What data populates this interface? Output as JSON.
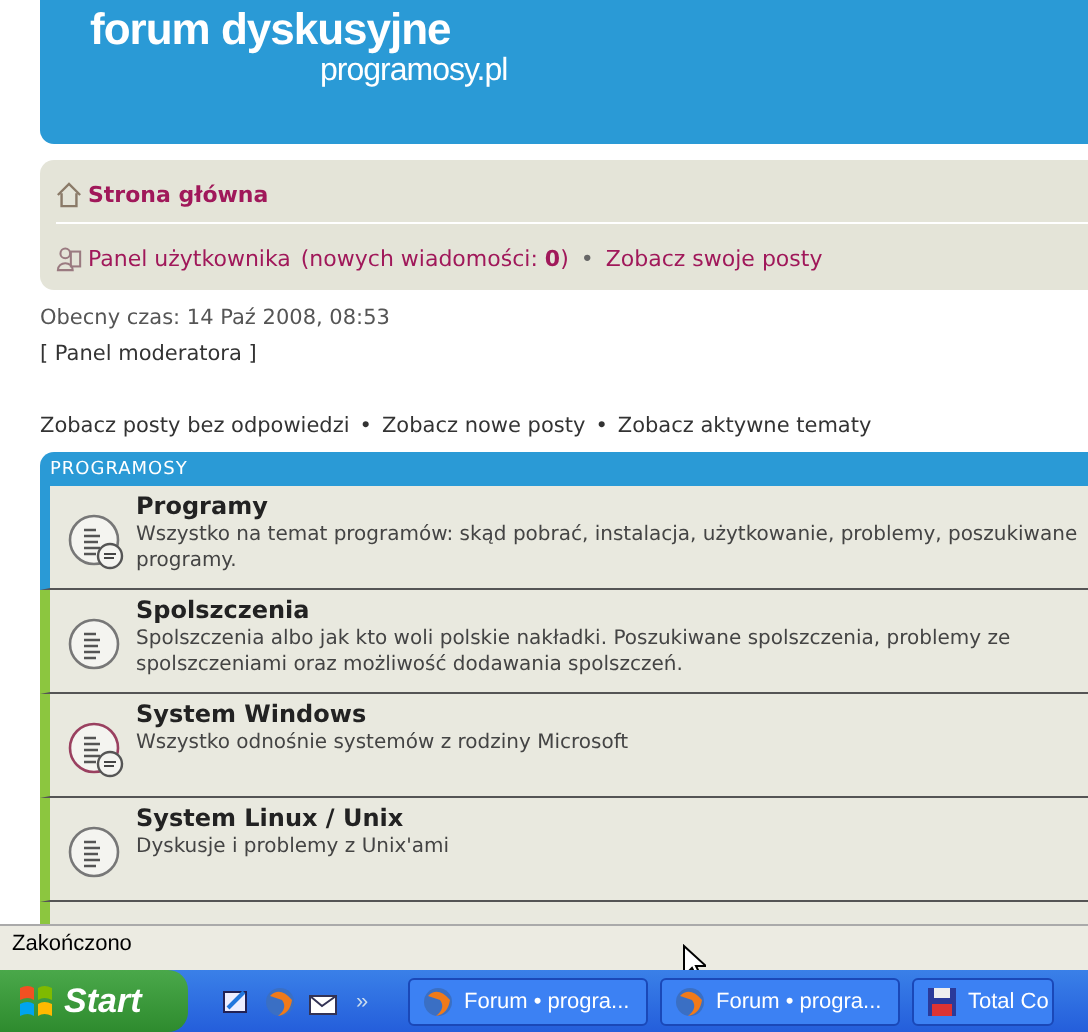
{
  "header": {
    "title": "forum dyskusyjne",
    "subtitle": "programosy.pl"
  },
  "nav": {
    "home": "Strona główna",
    "panel": "Panel użytkownika",
    "new_messages": "(nowych wiadomości: **0**)",
    "separator": "•",
    "own_posts": "Zobacz swoje posty"
  },
  "current_time": "Obecny czas: 14 Paź 2008, 08:53",
  "moderator_panel": "[ Panel moderatora ]",
  "quick_links": [
    "Zobacz posty bez odpowiedzi",
    "Zobacz nowe posty",
    "Zobacz aktywne tematy"
  ],
  "quick_separators": [
    "•",
    "•"
  ],
  "category": {
    "title": "PROGRAMOSY",
    "forums": [
      {
        "name": "Programy",
        "description": "Wszystko na temat programów: skąd pobrać, instalacja, użytkowanie, problemy, poszukiwane programy.",
        "new_posts": true,
        "color": "#2a9ad6"
      },
      {
        "name": "Spolszczenia",
        "description": "Spolszczenia albo jak kto woli polskie nakładki. Poszukiwane spolszczenia, problemy ze spolszczeniami oraz możliwość dodawania spolszczeń.",
        "new_posts": false,
        "color": "#8cc63f"
      },
      {
        "name": "System Windows",
        "description": "Wszystko odnośnie systemów z rodziny Microsoft",
        "new_posts": true,
        "color": "#8cc63f"
      },
      {
        "name": "System Linux / Unix",
        "description": "Dyskusje i problemy z Unix'ami",
        "new_posts": false,
        "color": "#8cc63f"
      }
    ]
  },
  "status_bar": "Zakończono",
  "taskbar": {
    "start": "Start",
    "more": "»",
    "tasks": [
      {
        "label": "Forum • progra...",
        "kind": "browser"
      },
      {
        "label": "Forum • progra...",
        "kind": "browser"
      },
      {
        "label": "Total Co",
        "kind": "disk"
      }
    ]
  }
}
